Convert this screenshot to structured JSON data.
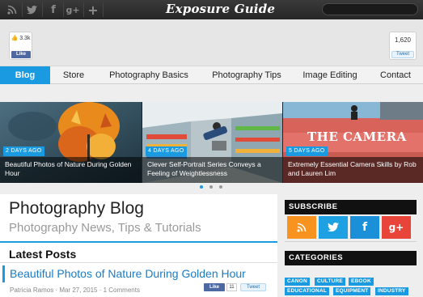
{
  "topbar": {
    "brand": "Exposure Guide",
    "social_icons": [
      {
        "name": "rss-icon",
        "glyph": "◉"
      },
      {
        "name": "twitter-icon",
        "glyph": "🐦"
      },
      {
        "name": "facebook-icon",
        "glyph": "f"
      },
      {
        "name": "googleplus-icon",
        "glyph": "g+"
      },
      {
        "name": "plus-icon",
        "glyph": "+"
      }
    ]
  },
  "share": {
    "facebook_count": "3.3k",
    "facebook_label": "Like",
    "twitter_count": "1,620",
    "twitter_label": "Tweet"
  },
  "nav": {
    "items": [
      "Blog",
      "Store",
      "Photography Basics",
      "Photography Tips",
      "Image Editing",
      "Contact"
    ],
    "active": "Blog"
  },
  "slider": {
    "slides": [
      {
        "age": "2 DAYS AGO",
        "caption": "Beautiful Photos of Nature During Golden Hour"
      },
      {
        "age": "4 DAYS AGO",
        "caption": "Clever Self-Portrait Series Conveys a Feeling of Weightlessness"
      },
      {
        "age": "5 DAYS AGO",
        "caption": "Extremely Essential Camera Skills by Rob and Lauren Lim",
        "image_text": "THE CAMERA"
      }
    ],
    "dot_count": 3,
    "active_dot": 0
  },
  "main": {
    "title": "Photography Blog",
    "subtitle": "Photography News, Tips & Tutorials",
    "section": "Latest Posts",
    "post": {
      "title": "Beautiful Photos of Nature During Golden Hour",
      "meta": "Patricia Ramos · Mar 27, 2015 · 1 Comments",
      "like_label": "Like",
      "like_count": "11",
      "tweet_label": "Tweet"
    }
  },
  "sidebar": {
    "subscribe": "SUBSCRIBE",
    "categories": "CATEGORIES",
    "subscribe_buttons": [
      {
        "name": "rss-icon",
        "glyph": "◉",
        "color": "#f7931e"
      },
      {
        "name": "twitter-icon",
        "glyph": "🐦",
        "color": "#1da1e2"
      },
      {
        "name": "facebook-icon",
        "glyph": "f",
        "color": "#1b8fd8"
      },
      {
        "name": "googleplus-icon",
        "glyph": "g+",
        "color": "#e8443a"
      }
    ],
    "category_tags": [
      "CANON",
      "CULTURE",
      "EBOOK",
      "EDUCATIONAL",
      "EQUIPMENT",
      "INDUSTRY"
    ]
  },
  "colors": {
    "accent": "#1a9ae0",
    "link": "#1a7bc4",
    "dark": "#111111"
  }
}
